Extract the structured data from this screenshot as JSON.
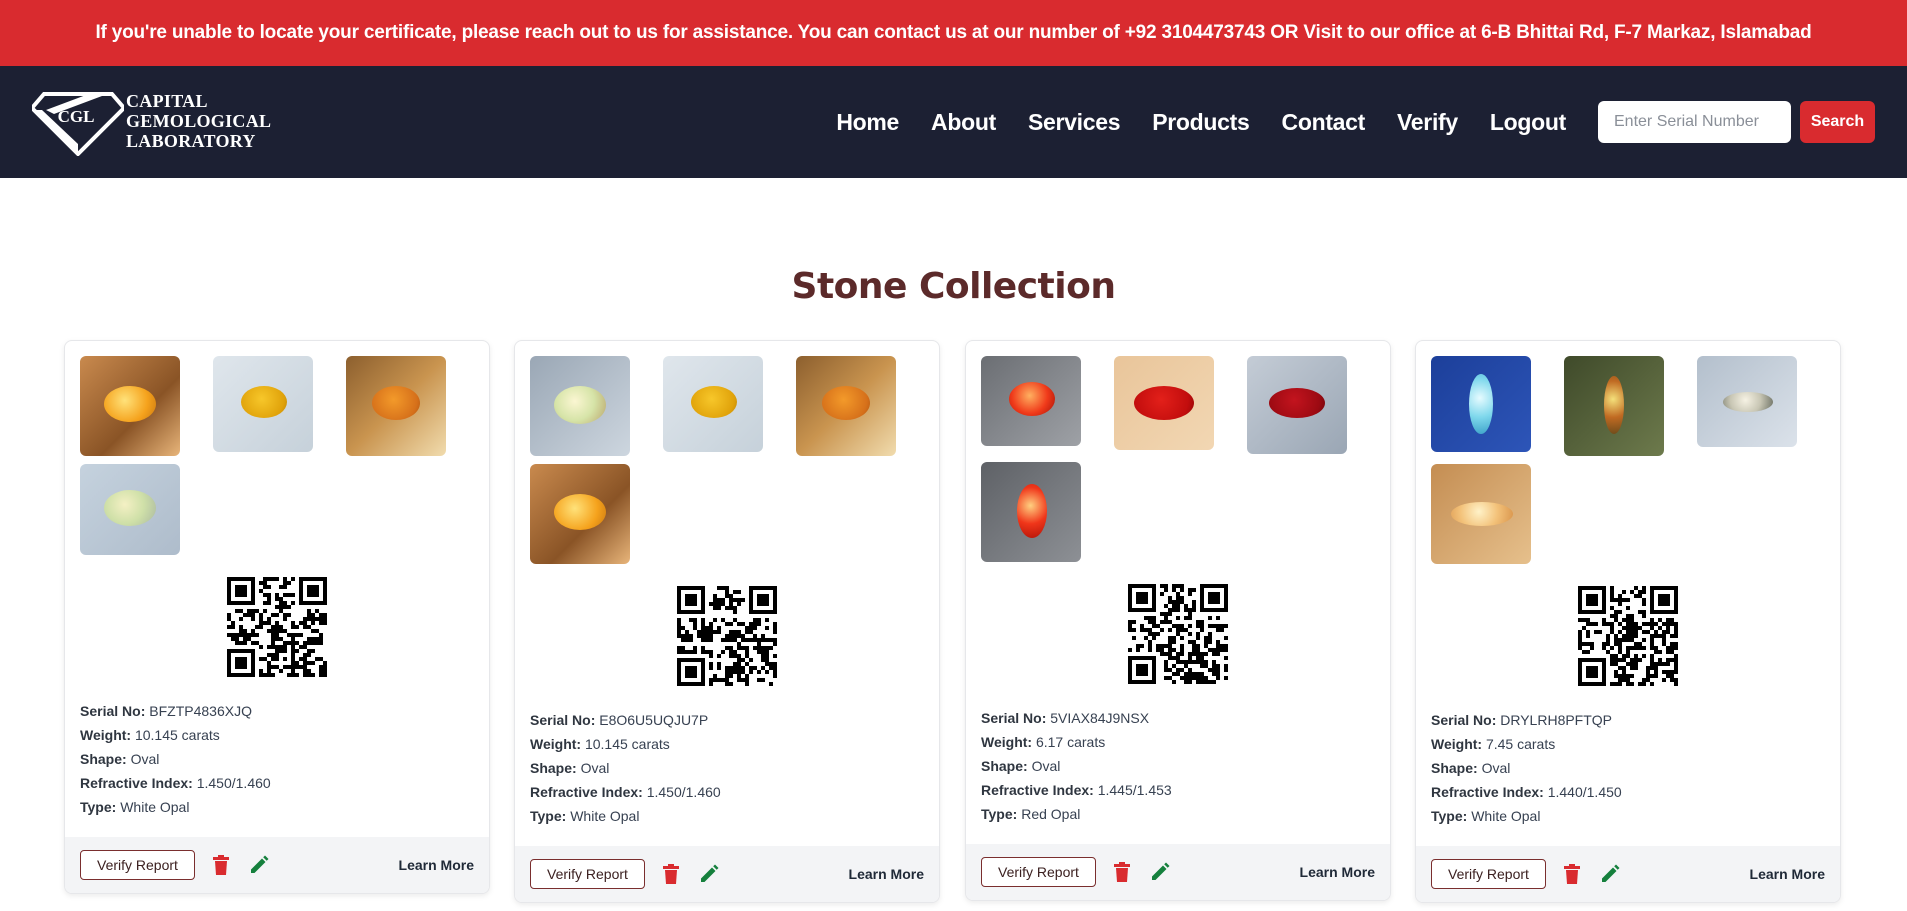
{
  "announcement": "If you're unable to locate your certificate, please reach out to us for assistance. You can contact us at our number of +92 3104473743 OR Visit to our office at 6-B Bhittai Rd, F-7 Markaz, Islamabad",
  "brand": {
    "logo_letters": "CGL",
    "line1": "CAPITAL",
    "line2": "GEMOLOGICAL",
    "line3": "LABORATORY"
  },
  "nav": {
    "items": [
      "Home",
      "About",
      "Services",
      "Products",
      "Contact",
      "Verify",
      "Logout"
    ],
    "search_placeholder": "Enter Serial Number",
    "search_label": "Search"
  },
  "colors": {
    "accent_red": "#d92b2f",
    "navbar_bg": "#1c2033",
    "title_maroon": "#5c2a2a",
    "edit_green": "#15803d"
  },
  "section_title": "Stone Collection",
  "labels": {
    "serial": "Serial No:",
    "weight": "Weight:",
    "shape": "Shape:",
    "refractive_index": "Refractive Index:",
    "type": "Type:",
    "verify_button": "Verify Report",
    "learn_more": "Learn More"
  },
  "icons": {
    "delete": "trash-icon",
    "edit": "pencil-icon"
  },
  "cards": [
    {
      "serial": "BFZTP4836XJQ",
      "weight": "10.145 carats",
      "shape": "Oval",
      "refractive_index": "1.450/1.460",
      "type": "White Opal"
    },
    {
      "serial": "E8O6U5UQJU7P",
      "weight": "10.145 carats",
      "shape": "Oval",
      "refractive_index": "1.450/1.460",
      "type": "White Opal"
    },
    {
      "serial": "5VIAX84J9NSX",
      "weight": "6.17 carats",
      "shape": "Oval",
      "refractive_index": "1.445/1.453",
      "type": "Red Opal"
    },
    {
      "serial": "DRYLRH8PFTQP",
      "weight": "7.45 carats",
      "shape": "Oval",
      "refractive_index": "1.440/1.450",
      "type": "White Opal"
    }
  ]
}
